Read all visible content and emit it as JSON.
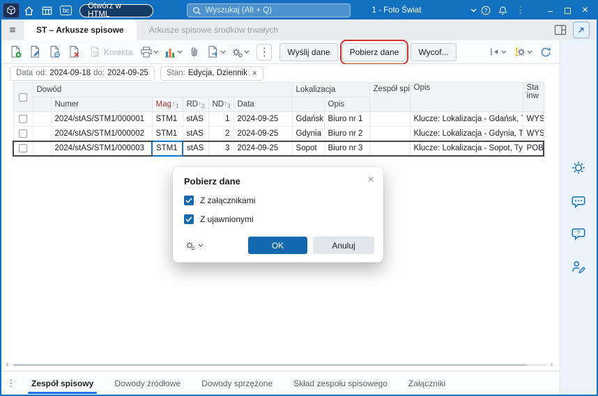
{
  "icons": {
    "menu": "≡",
    "kebab": "⋮",
    "minimize": "–",
    "close": "×",
    "chip_remove": "×",
    "dialog_close": "×",
    "scroll_left": "‹",
    "scroll_right": "›",
    "sort_asc": "↑",
    "bc_badge": "bc"
  },
  "topbar": {
    "open_in_html": "Otwórz w HTML",
    "search_placeholder": "Wyszukaj (Alt + Q)",
    "company": "1 - Foto Świat"
  },
  "tabs": {
    "active": "ST – Arkusze spisowe",
    "inactive": "Arkusze spisowe środków trwałych"
  },
  "toolbar": {
    "korekta": "Korekta",
    "send": "Wyślij dane",
    "download": "Pobierz dane",
    "withdraw": "Wycof..."
  },
  "filters": {
    "date_label": "Data",
    "od_label": "od:",
    "od_value": "2024-09-18",
    "do_label": "do:",
    "do_value": "2024-09-25",
    "stan_label": "Stan:",
    "stan_value": "Edycja, Dziennik"
  },
  "table": {
    "headers": {
      "dowod": "Dowód",
      "numer": "Numer",
      "mag": "Mag",
      "rd": "RD",
      "nd": "ND",
      "data": "Data",
      "lokalizacja": "Lokalizacja",
      "lok_opis": "Opis",
      "zespol": "Zespół spisowy",
      "opis": "Opis",
      "stan_line1": "Sta",
      "stan_line2": "inw"
    },
    "sort": {
      "mag": "1",
      "rd": "2",
      "nd": "3"
    },
    "rows": [
      {
        "numer": "2024/stAS/STM1/000001",
        "mag": "STM1",
        "rd": "stAS",
        "nd": "1",
        "data": "2024-09-25",
        "lok": "Gdańsk",
        "lok_opis": "Biuro nr 1",
        "zespol": "",
        "opis": "Klucze: Lokalizacja - Gdańsk, Typ",
        "stan": "WYSŁ"
      },
      {
        "numer": "2024/stAS/STM1/000002",
        "mag": "STM1",
        "rd": "stAS",
        "nd": "2",
        "data": "2024-09-25",
        "lok": "Gdynia",
        "lok_opis": "Biuro nr 2",
        "zespol": "",
        "opis": "Klucze: Lokalizacja - Gdynia, Typ",
        "stan": "WYSŁ"
      },
      {
        "numer": "2024/stAS/STM1/000003",
        "mag": "STM1",
        "rd": "stAS",
        "nd": "3",
        "data": "2024-09-25",
        "lok": "Sopot",
        "lok_opis": "Biuro nr 3",
        "zespol": "",
        "opis": "Klucze: Lokalizacja - Sopot, Typ",
        "stan": "POBR"
      }
    ]
  },
  "dialog": {
    "title": "Pobierz dane",
    "option1": "Z załącznikami",
    "option2": "Z ujawnionymi",
    "ok": "OK",
    "cancel": "Anuluj"
  },
  "bottom_tabs": [
    {
      "label": "Zespół spisowy"
    },
    {
      "label": "Dowody źródłowe"
    },
    {
      "label": "Dowody sprzężone"
    },
    {
      "label": "Skład zespołu spisowego"
    },
    {
      "label": "Załączniki"
    }
  ],
  "colors": {
    "accent_blue": "#1170bf",
    "annotation_red": "#d92f2a",
    "numer_cell_purple": "#dcd0ec",
    "ok_button_blue": "#1569af",
    "sorted_header_red": "#a03a38"
  }
}
